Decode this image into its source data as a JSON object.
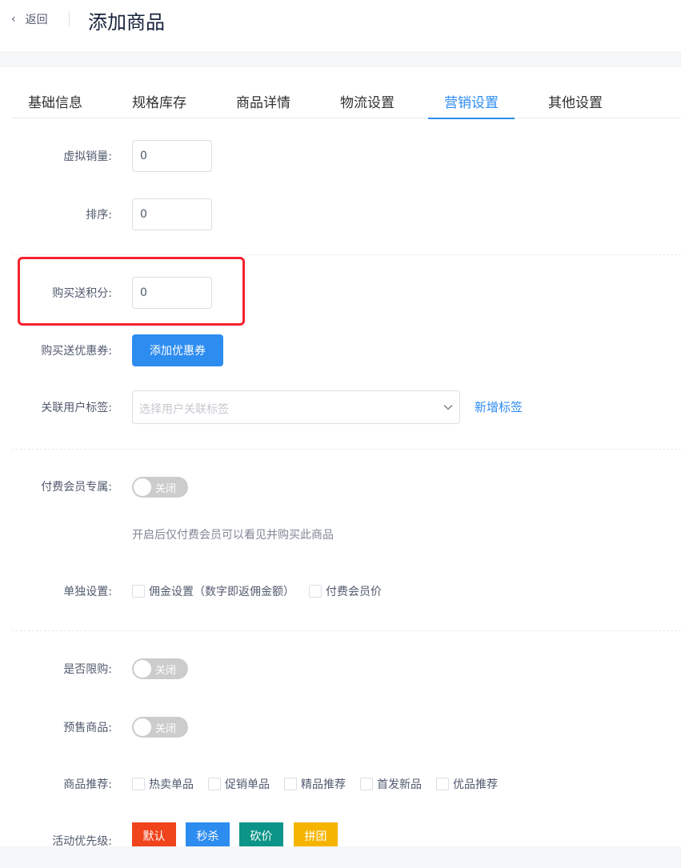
{
  "header": {
    "back_label": "返回",
    "title": "添加商品"
  },
  "tabs": [
    "基础信息",
    "规格库存",
    "商品详情",
    "物流设置",
    "营销设置",
    "其他设置"
  ],
  "active_tab": "营销设置",
  "form": {
    "virtual_sales": {
      "label": "虚拟销量:",
      "value": "0"
    },
    "sort": {
      "label": "排序:",
      "value": "0"
    },
    "give_points": {
      "label": "购买送积分:",
      "value": "0"
    },
    "give_coupon": {
      "label": "购买送优惠券:",
      "button": "添加优惠券"
    },
    "user_tags": {
      "label": "关联用户标签:",
      "placeholder": "选择用户关联标签",
      "link": "新增标签"
    },
    "vip_exclusive": {
      "label": "付费会员专属:",
      "state": "关闭",
      "hint": "开启后仅付费会员可以看见并购买此商品"
    },
    "separate": {
      "label": "单独设置:",
      "options": [
        "佣金设置（数字即返佣金额）",
        "付费会员价"
      ]
    },
    "limit_buy": {
      "label": "是否限购:",
      "state": "关闭"
    },
    "presale": {
      "label": "预售商品:",
      "state": "关闭"
    },
    "recommend": {
      "label": "商品推荐:",
      "options": [
        "热卖单品",
        "促销单品",
        "精品推荐",
        "首发新品",
        "优品推荐"
      ]
    },
    "priority": {
      "label": "活动优先级:",
      "tags": [
        {
          "text": "默认",
          "color": "#f0441c"
        },
        {
          "text": "秒杀",
          "color": "#2d8cf0"
        },
        {
          "text": "砍价",
          "color": "#0c9488"
        },
        {
          "text": "拼团",
          "color": "#f5b400"
        }
      ]
    }
  },
  "colors": {
    "primary": "#2d8cf0",
    "highlight": "#f5222d"
  }
}
